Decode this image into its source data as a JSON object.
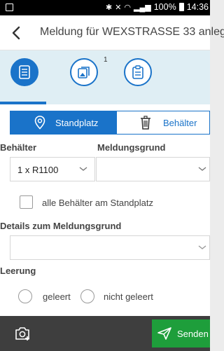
{
  "status_bar": {
    "battery": "100%",
    "time": "14:36"
  },
  "app_bar": {
    "title": "Meldung für WEXSTRASSE 33 anleg."
  },
  "tabs": [
    {
      "icon": "list-icon",
      "active": true
    },
    {
      "icon": "photo-copy-icon",
      "badge": "1"
    },
    {
      "icon": "clipboard-icon"
    }
  ],
  "segment": {
    "standplatz_label": "Standplatz",
    "behaelter_label": "Behälter",
    "active": "Standplatz"
  },
  "form": {
    "behaelter_label": "Behälter",
    "meldungsgrund_label": "Meldungsgrund",
    "behaelter_value": "1 x R1100",
    "meldungsgrund_value": "",
    "alle_behaelter_label": "alle Behälter am Standplatz",
    "alle_behaelter_checked": false,
    "details_label": "Details zum Meldungsgrund",
    "details_value": "",
    "leerung_label": "Leerung",
    "leerung_options": [
      "geleert",
      "nicht geleert"
    ],
    "leerung_selected": ""
  },
  "bottom_bar": {
    "send_label": "Senden"
  },
  "colors": {
    "accent": "#1a73c9",
    "tab_band": "#dfeef4",
    "send": "#1e9e3b",
    "bottom_bar": "#3e3e3e"
  }
}
